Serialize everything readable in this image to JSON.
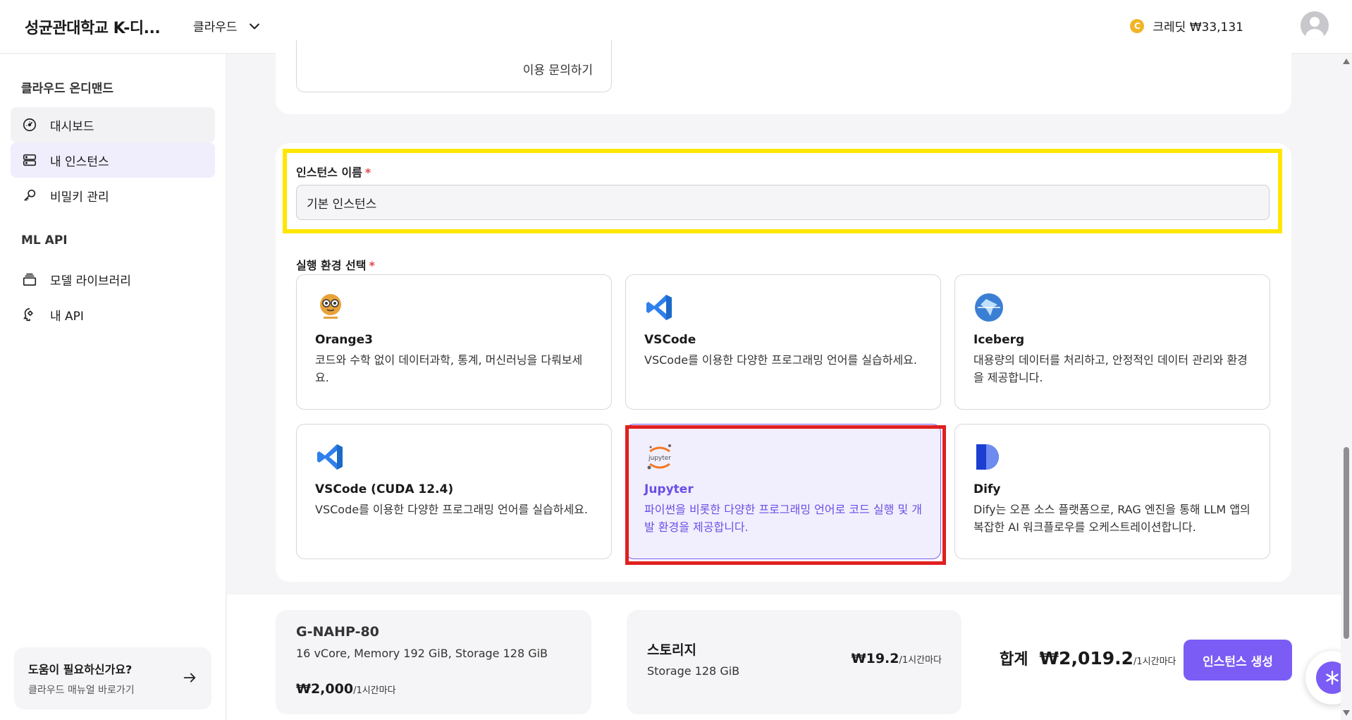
{
  "header": {
    "brand": "성균관대학교 K-디...",
    "nav_label": "클라우드",
    "credit_label": "크레딧 ₩33,131",
    "coin_letter": "C"
  },
  "sidebar": {
    "section1": "클라우드 온디맨드",
    "items1": [
      {
        "label": "대시보드",
        "icon": "dashboard-icon"
      },
      {
        "label": "내 인스턴스",
        "icon": "server-icon"
      },
      {
        "label": "비밀키 관리",
        "icon": "key-icon"
      }
    ],
    "section2": "ML API",
    "items2": [
      {
        "label": "모델 라이브러리",
        "icon": "library-icon"
      },
      {
        "label": "내 API",
        "icon": "api-icon"
      }
    ],
    "help": {
      "title": "도움이 필요하신가요?",
      "subtitle": "클라우드 매뉴얼 바로가기"
    }
  },
  "top_card": {
    "inquiry_link": "이용 문의하기"
  },
  "form": {
    "name_label": "인스턴스 이름",
    "required_mark": "*",
    "name_value": "기본 인스턴스",
    "env_label": "실행 환경 선택"
  },
  "environments": [
    {
      "title": "Orange3",
      "desc": "코드와 수학 없이 데이터과학, 통계, 머신러닝을 다뤄보세요.",
      "icon": "orange3-icon",
      "selected": false
    },
    {
      "title": "VSCode",
      "desc": "VSCode를 이용한 다양한 프로그래밍 언어를 실습하세요.",
      "icon": "vscode-icon",
      "selected": false
    },
    {
      "title": "Iceberg",
      "desc": "대용량의 데이터를 처리하고, 안정적인 데이터 관리와 환경을 제공합니다.",
      "icon": "iceberg-icon",
      "selected": false
    },
    {
      "title": "VSCode (CUDA 12.4)",
      "desc": "VSCode를 이용한 다양한 프로그래밍 언어를 실습하세요.",
      "icon": "vscode-icon",
      "selected": false
    },
    {
      "title": "Jupyter",
      "desc": "파이썬을 비롯한 다양한 프로그래밍 언어로 코드 실행 및 개발 환경을 제공합니다.",
      "icon": "jupyter-icon",
      "selected": true
    },
    {
      "title": "Dify",
      "desc": "Dify는 오픈 소스 플랫폼으로, RAG 엔진을 통해 LLM 앱의 복잡한 AI 워크플로우를 오케스트레이션합니다.",
      "icon": "dify-icon",
      "selected": false
    }
  ],
  "summary": {
    "spec_name": "G-NAHP-80",
    "spec_detail": "16 vCore, Memory 192 GiB, Storage 128 GiB",
    "spec_price": "₩2,000",
    "per_hour": "/1시간마다",
    "storage_title": "스토리지",
    "storage_detail": "Storage 128 GiB",
    "storage_price": "₩19.2",
    "total_label": "합계",
    "total_price": "₩2,019.2",
    "create_button": "인스턴스 생성"
  },
  "colors": {
    "accent": "#7b5cf5",
    "highlight_yellow": "#ffe600",
    "highlight_red": "#e02020"
  }
}
